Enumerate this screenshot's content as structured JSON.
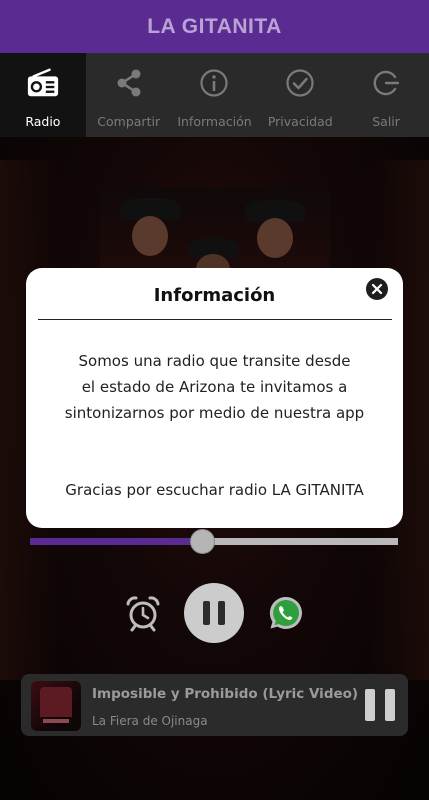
{
  "app": {
    "title": "LA GITANITA",
    "accent_color": "#5a2c92"
  },
  "tabs": [
    {
      "label": "Radio",
      "icon": "radio-icon",
      "active": true
    },
    {
      "label": "Compartir",
      "icon": "share-icon",
      "active": false
    },
    {
      "label": "Información",
      "icon": "info-icon",
      "active": false
    },
    {
      "label": "Privacidad",
      "icon": "check-circle-icon",
      "active": false
    },
    {
      "label": "Salir",
      "icon": "exit-icon",
      "active": false
    }
  ],
  "dialog": {
    "title": "Información",
    "body_lines": [
      "Somos una radio que transite desde",
      "el estado de Arizona te invitamos a",
      "sintonizarnos por medio de nuestra app"
    ],
    "thanks": "Gracias por escuchar radio LA GITANITA"
  },
  "player": {
    "progress_fraction": 0.47,
    "state": "playing"
  },
  "now_playing": {
    "song": "Imposible y Prohibido (Lyric Video)",
    "artist": "La Fiera de Ojinaga"
  }
}
